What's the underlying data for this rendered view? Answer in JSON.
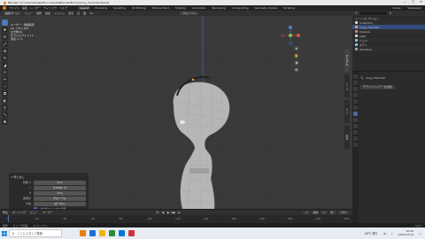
{
  "window": {
    "title": "Blender* [C:\\Users\\tanaka\\Documents\\Blender\\Bunny\\mug_character.blend]",
    "controls": [
      "—",
      "□",
      "✕"
    ]
  },
  "menubar": {
    "menus": [
      "ファイル",
      "編集",
      "レンダー",
      "ウィンドウ",
      "ヘルプ"
    ],
    "workspaces": [
      "Layout",
      "Modeling",
      "Sculpting",
      "UV Editing",
      "Texture Paint",
      "Shading",
      "Animation",
      "Rendering",
      "Compositing",
      "Geometry Nodes",
      "Scripting"
    ],
    "active_workspace": "Layout",
    "scene_label": "Scene",
    "viewlayer_label": "ViewLayer"
  },
  "viewport_header": {
    "mode": "編集モード",
    "items": [
      "ビュー",
      "選択",
      "追加",
      "メッシュ",
      "頂点",
      "辺",
      "面",
      "UV"
    ],
    "transform": "グローバル",
    "view_label": "ユーザー・透視投影"
  },
  "stats": {
    "lines": [
      "ユーザー・透視投影",
      "(1) スタイルM",
      "立方体(1)",
      "オブジェクト 1 / 1",
      "頂点 1 / 1"
    ]
  },
  "gizmo": {
    "x": "X",
    "y": "Y",
    "z": "Z"
  },
  "toolbar": {
    "tools": [
      "⬚",
      "✥",
      "⟳",
      "⤢",
      "⊞",
      "✎",
      "◢",
      "⬠",
      "✂",
      "⌁",
      "⧉",
      "◐",
      "⚲",
      "⤡",
      "✱"
    ]
  },
  "npanel_tabs": [
    "アイテム",
    "ツール",
    "ビュー",
    "編集"
  ],
  "lastop": {
    "title": "▾ 押し出し",
    "rows": [
      {
        "label": "移動 X",
        "value": "0 m"
      },
      {
        "label": "Y",
        "value": "0.0001 m"
      },
      {
        "label": "Z",
        "value": "0 m"
      },
      {
        "label": "座標系",
        "value": "グローバル"
      },
      {
        "label": "方向",
        "value": "ローカル"
      }
    ],
    "checkbox_label": "プロポーショナル編集"
  },
  "outliner": {
    "title": "シーンコレクション",
    "rows": [
      {
        "label": "Collection",
        "color": "#d8d8d8"
      },
      {
        "label": "mug_character",
        "color": "#f0a050"
      },
      {
        "label": "Camera",
        "color": "#d88"
      },
      {
        "label": "Light",
        "color": "#ddd"
      },
      {
        "label": "ヘッド",
        "color": "#8cf"
      },
      {
        "label": "ボディ",
        "color": "#8cf"
      },
      {
        "label": "Armature",
        "color": "#aaa"
      }
    ]
  },
  "properties": {
    "object_name": "mug_character",
    "section": "モディファイアーを追加"
  },
  "timeline": {
    "menus": [
      "再生",
      "キーイング",
      "ビュー",
      "マーカー"
    ],
    "ticks": [
      "0",
      "20",
      "40",
      "60",
      "80",
      "100",
      "120",
      "140",
      "160",
      "180",
      "200",
      "220",
      "240"
    ],
    "current_frame": "1",
    "start_label": "開始",
    "start": "1",
    "end_label": "終了",
    "end": "250",
    "play_icons": [
      "⏮",
      "◀",
      "▶",
      "▶▶",
      "⏭"
    ]
  },
  "statusbar": {
    "items": [
      "選択",
      "ビューを回転",
      "オブジェクト"
    ],
    "version": "3.6.0"
  },
  "taskbar": {
    "search_placeholder": "ここに入力して検索",
    "time": "16:26",
    "date": "2023/07/19",
    "app_colors": [
      "#e87d0d",
      "#1f6fd0",
      "#f4b400",
      "#2b8a3e",
      "#0078d4",
      "#d13438"
    ],
    "weather": "28°C 曇り"
  },
  "colors": {
    "accent": "#4772b3",
    "x_axis": "#e24f4f",
    "y_axis": "#7fbf3f",
    "z_axis": "#4b7fd6"
  }
}
